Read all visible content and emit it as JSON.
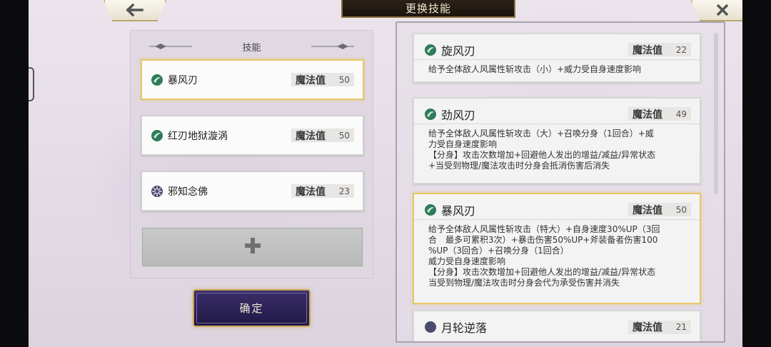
{
  "header": {
    "title": "更换技能",
    "back_icon": "arrow-left-icon",
    "close_icon": "close-icon"
  },
  "left_panel": {
    "title": "技能",
    "equipped": [
      {
        "name": "暴风刃",
        "mp_label": "魔法值",
        "mp": "50",
        "icon": "wind-icon",
        "selected": true
      },
      {
        "name": "红刃地狱漩涡",
        "mp_label": "魔法值",
        "mp": "50",
        "icon": "wind-icon",
        "selected": false
      },
      {
        "name": "邪知念佛",
        "mp_label": "魔法值",
        "mp": "23",
        "icon": "dark-icon",
        "selected": false
      }
    ],
    "add_icon": "plus-icon"
  },
  "confirm_label": "确定",
  "skills": [
    {
      "name": "旋风刃",
      "mp_label": "魔法值",
      "mp": "22",
      "icon": "wind-icon",
      "desc": "给予全体敌人风属性斩攻击（小）+威力受自身速度影响"
    },
    {
      "name": "劲风刃",
      "mp_label": "魔法值",
      "mp": "49",
      "icon": "wind-icon",
      "desc": "给予全体敌人风属性斩攻击（大）+召唤分身（1回合）+威\n力受自身速度影响\n【分身】攻击次数增加+回避他人发出的增益/减益/异常状态\n+当受到物理/魔法攻击时分身会抵消伤害后消失"
    },
    {
      "name": "暴风刃",
      "mp_label": "魔法值",
      "mp": "50",
      "icon": "wind-icon",
      "desc": "给予全体敌人风属性斩攻击（特大）+自身速度30%UP（3回\n合　最多可累积3次）+暴击伤害50%UP+斧装备者伤害100\n%UP（3回合）+召唤分身（1回合）\n威力受自身速度影响\n【分身】攻击次数增加+回避他人发出的增益/减益/异常状态\n当受到物理/魔法攻击时分身会代为承受伤害并消失"
    },
    {
      "name": "月轮逆落",
      "mp_label": "魔法值",
      "mp": "21",
      "icon": "moon-icon",
      "desc": ""
    }
  ],
  "colors": {
    "accent_gold": "#e7c66a",
    "wind_green": "#3f8f6a",
    "confirm_purple": "#2c2358"
  }
}
